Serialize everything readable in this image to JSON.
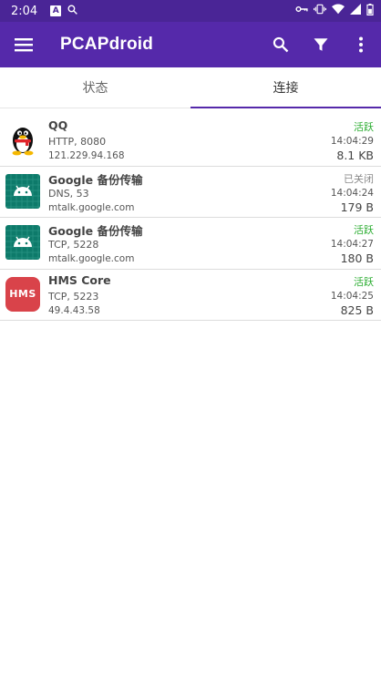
{
  "status_bar": {
    "time": "2:04",
    "icons_left": [
      "notification-a-icon",
      "search-icon"
    ],
    "icons_right": [
      "vpn-key-icon",
      "vibrate-icon",
      "wifi-icon",
      "signal-icon",
      "battery-icon"
    ],
    "notification_letter": "A"
  },
  "app_bar": {
    "title": "PCAPdroid",
    "background": "#5529aa",
    "icons": [
      "menu-icon",
      "search-icon",
      "filter-icon",
      "more-vert-icon"
    ]
  },
  "tabs": [
    {
      "label": "状态",
      "selected": false
    },
    {
      "label": "连接",
      "selected": true
    }
  ],
  "connections": [
    {
      "app": "QQ",
      "icon": "qq-penguin-icon",
      "protocol": "HTTP, 8080",
      "host": "121.229.94.168",
      "status": "活跃",
      "status_kind": "active",
      "time": "14:04:29",
      "size": "8.1 KB"
    },
    {
      "app": "Google 备份传输",
      "icon": "android-icon",
      "protocol": "DNS, 53",
      "host": "mtalk.google.com",
      "status": "已关闭",
      "status_kind": "closed",
      "time": "14:04:24",
      "size": "179 B"
    },
    {
      "app": "Google 备份传输",
      "icon": "android-icon",
      "protocol": "TCP, 5228",
      "host": "mtalk.google.com",
      "status": "活跃",
      "status_kind": "active",
      "time": "14:04:27",
      "size": "180 B"
    },
    {
      "app": "HMS Core",
      "icon": "hms-icon",
      "icon_text": "HMS",
      "protocol": "TCP, 5223",
      "host": "49.4.43.58",
      "status": "活跃",
      "status_kind": "active",
      "time": "14:04:25",
      "size": "825 B"
    }
  ],
  "colors": {
    "status_active": "#2eae34",
    "status_closed": "#8a8a8a",
    "accent": "#5529aa"
  }
}
